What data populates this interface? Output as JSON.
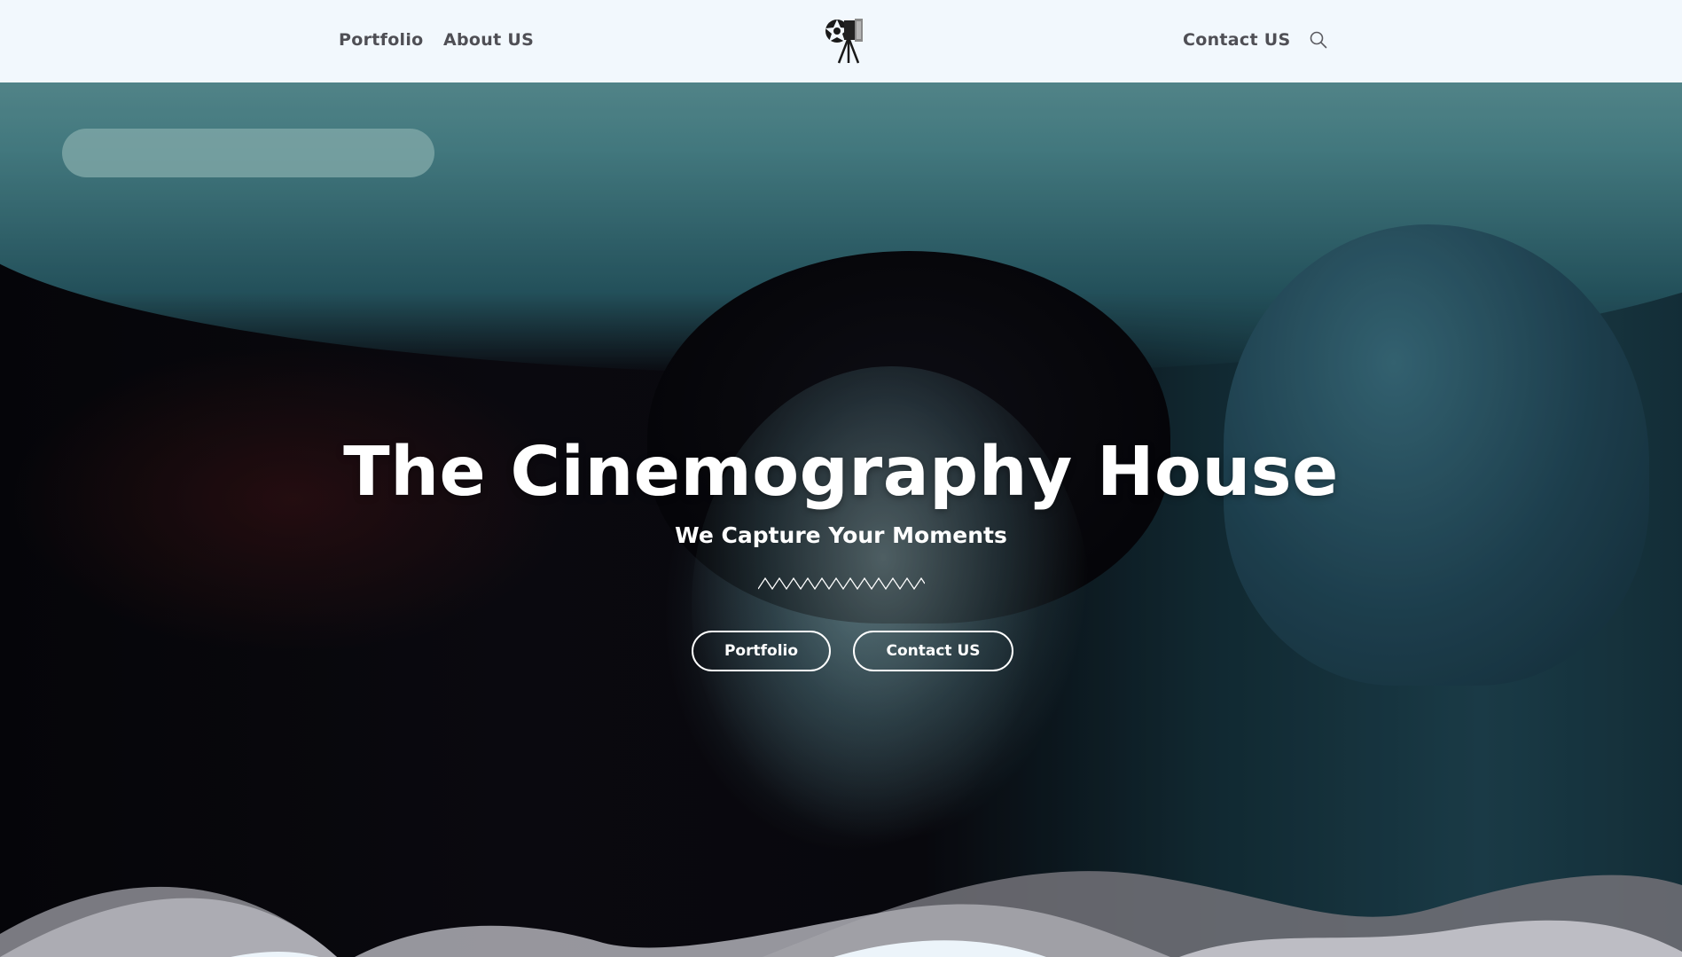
{
  "header": {
    "nav_left": [
      "Portfolio",
      "About US"
    ],
    "nav_right": [
      "Contact US"
    ],
    "logo_icon": "film-camera-logo-icon",
    "search_icon": "search-icon"
  },
  "hero": {
    "title": "The Cinemography House",
    "subtitle": "We Capture Your Moments",
    "divider_icon": "zigzag-divider-icon",
    "buttons": [
      "Portfolio",
      "Contact US"
    ]
  },
  "colors": {
    "header_bg": "#f2f8fd",
    "nav_text": "#4f4f55",
    "hero_text": "#ffffff"
  }
}
